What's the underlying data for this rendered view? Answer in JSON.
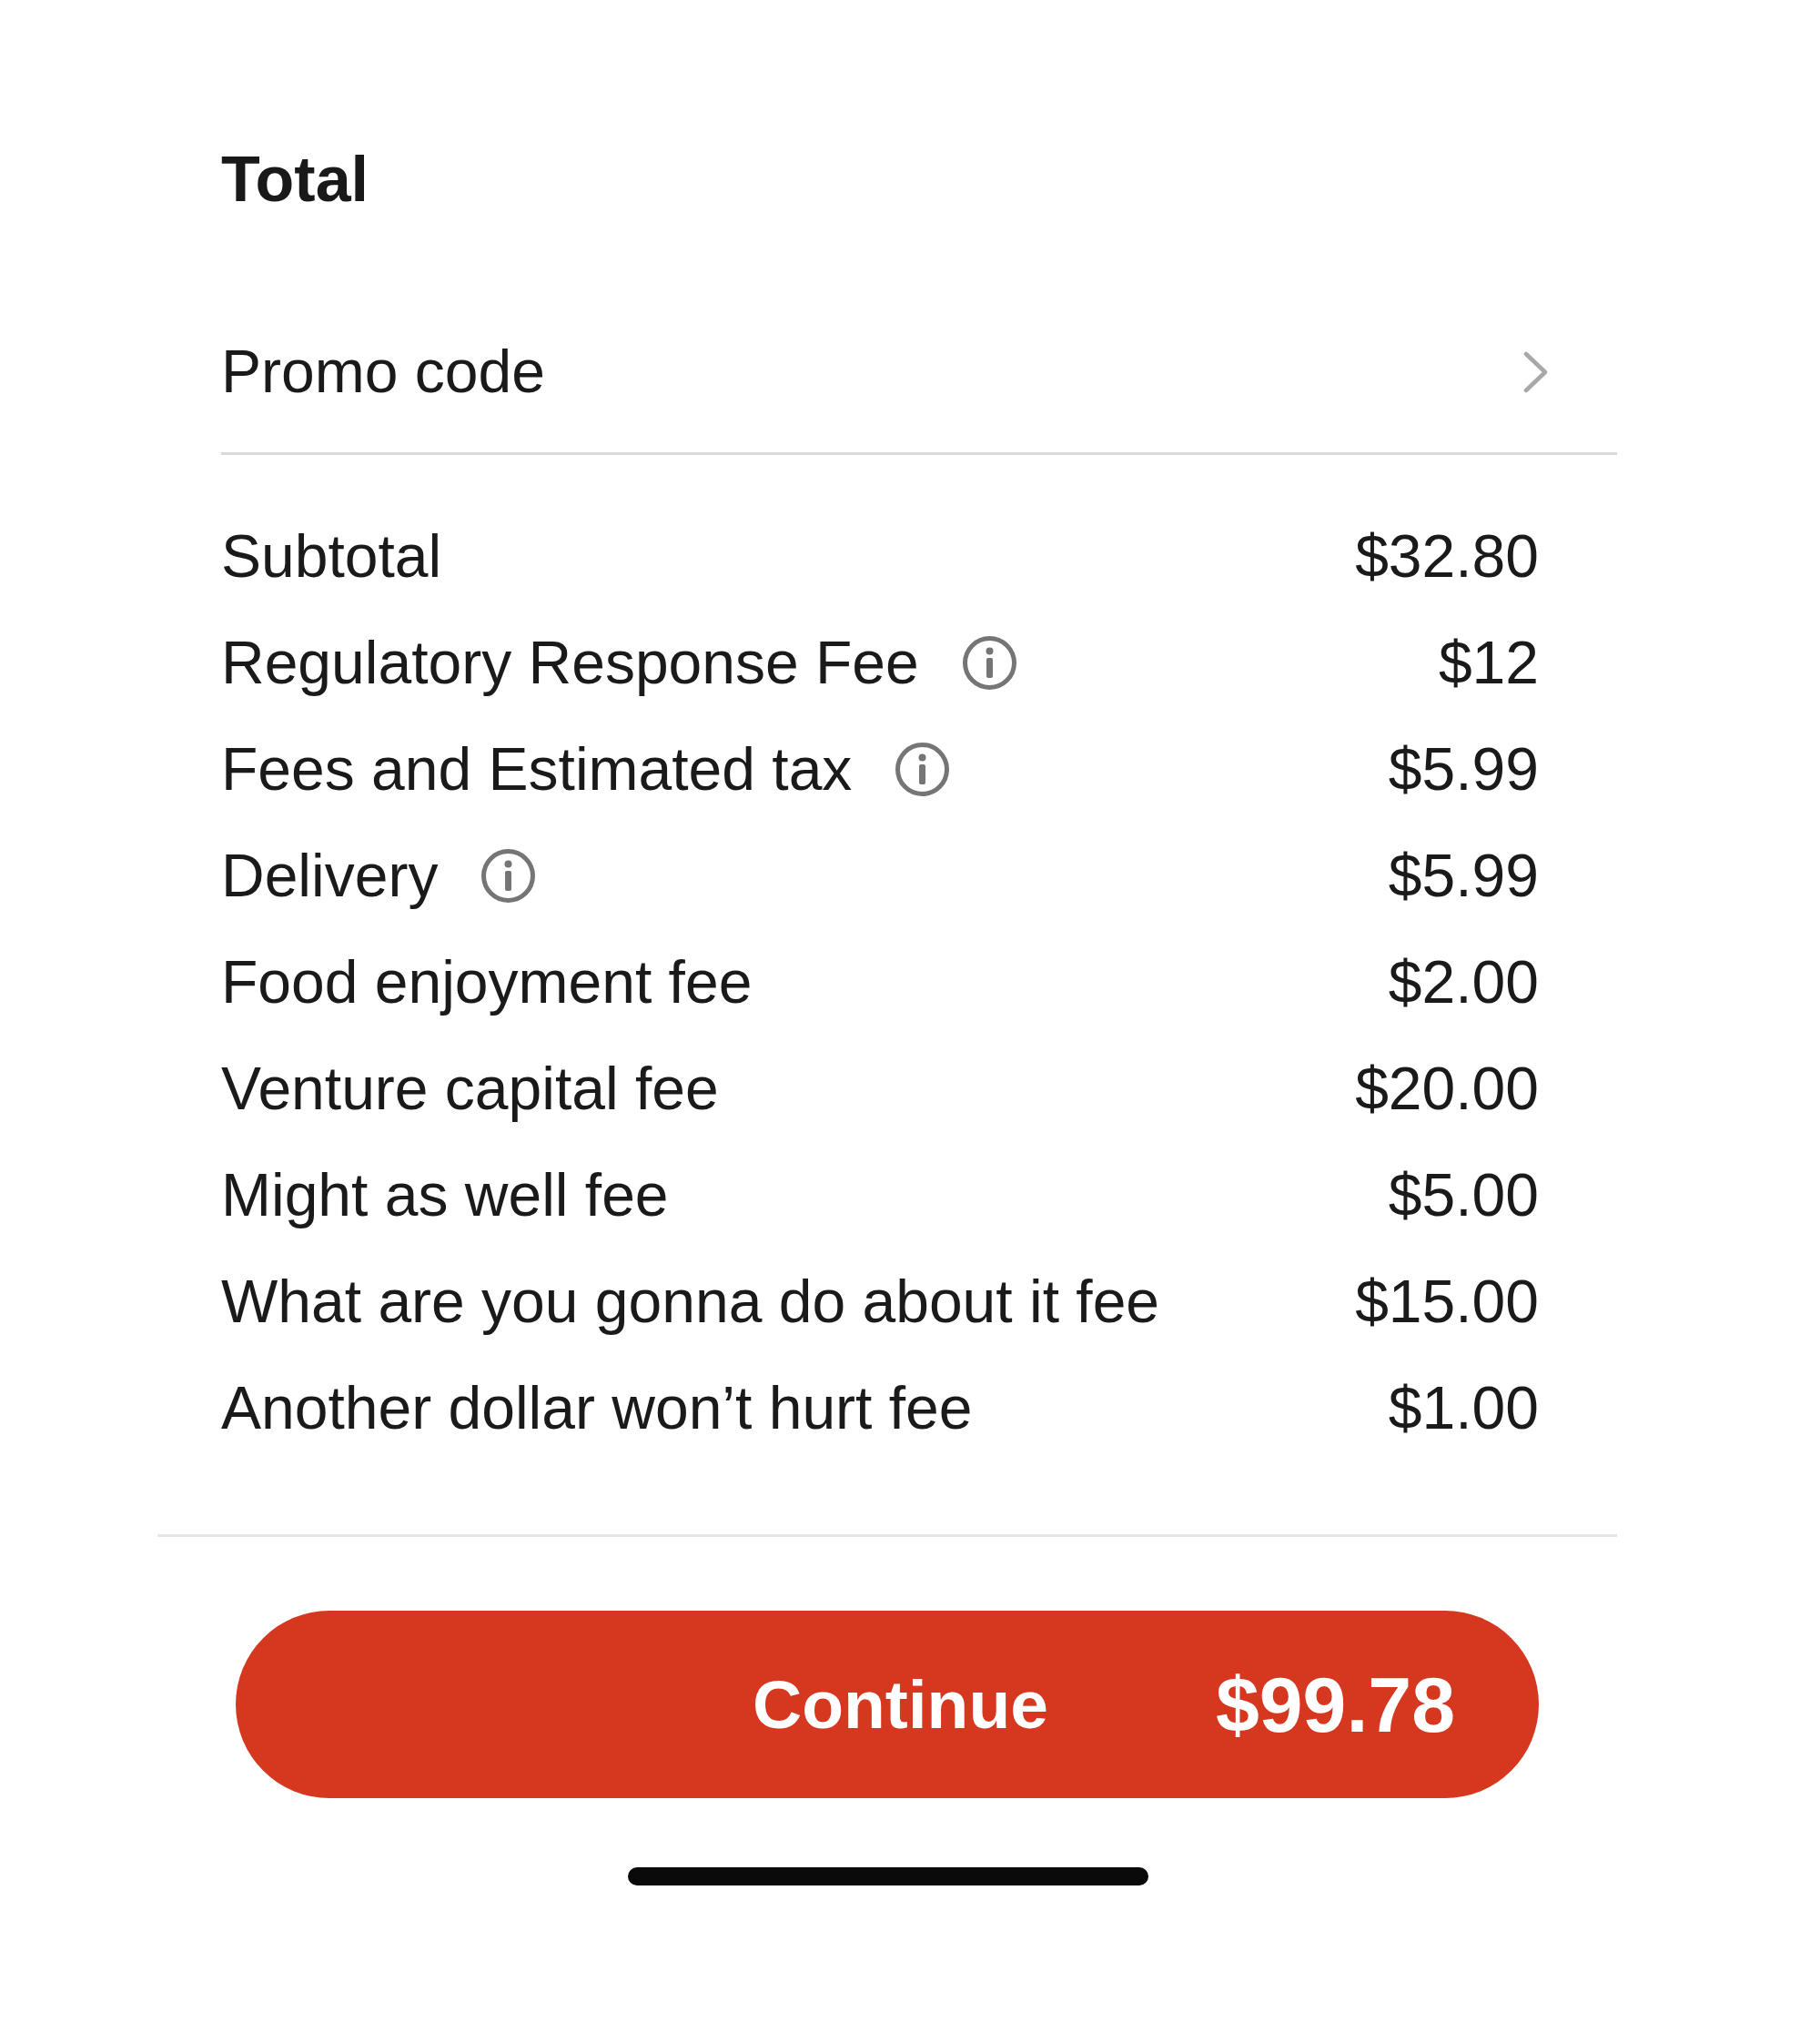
{
  "title": "Total",
  "promo": {
    "label": "Promo code"
  },
  "line_items": [
    {
      "label": "Subtotal",
      "amount": "$32.80",
      "info": false
    },
    {
      "label": "Regulatory Response Fee",
      "amount": "$12",
      "info": true
    },
    {
      "label": "Fees and Estimated tax",
      "amount": "$5.99",
      "info": true
    },
    {
      "label": "Delivery",
      "amount": "$5.99",
      "info": true
    },
    {
      "label": "Food enjoyment fee",
      "amount": "$2.00",
      "info": false
    },
    {
      "label": "Venture capital fee",
      "amount": "$20.00",
      "info": false
    },
    {
      "label": "Might as well fee",
      "amount": "$5.00",
      "info": false
    },
    {
      "label": "What are you gonna do about it fee",
      "amount": "$15.00",
      "info": false
    },
    {
      "label": "Another dollar won’t hurt fee",
      "amount": "$1.00",
      "info": false
    }
  ],
  "continue_button": {
    "label": "Continue",
    "amount": "$99.78"
  }
}
